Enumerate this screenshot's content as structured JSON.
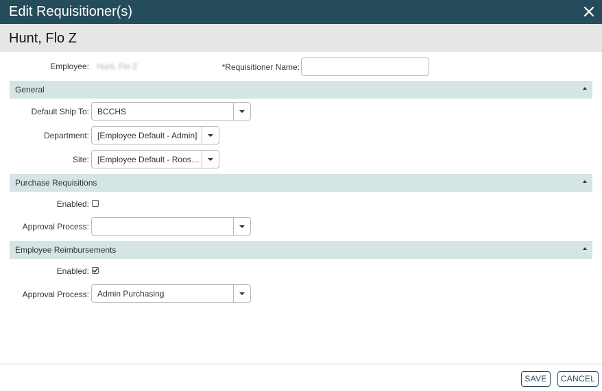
{
  "dialog": {
    "title": "Edit Requisitioner(s)",
    "person_name": "Hunt, Flo Z"
  },
  "top_fields": {
    "employee_label": "Employee:",
    "employee_value": "Hunt, Flo Z",
    "required_marker": "*",
    "requisitioner_name_label": "Requisitioner Name:",
    "requisitioner_name_value": ""
  },
  "sections": {
    "general": {
      "title": "General",
      "default_ship_to_label": "Default Ship To:",
      "default_ship_to_value": "BCCHS",
      "department_label": "Department:",
      "department_value": "[Employee Default - Admin]",
      "site_label": "Site:",
      "site_value": "[Employee Default - Roosevelt]"
    },
    "purchase_requisitions": {
      "title": "Purchase Requisitions",
      "enabled_label": "Enabled:",
      "enabled": false,
      "approval_process_label": "Approval Process:",
      "approval_process_value": ""
    },
    "employee_reimbursements": {
      "title": "Employee Reimbursements",
      "enabled_label": "Enabled:",
      "enabled": true,
      "approval_process_label": "Approval Process:",
      "approval_process_value": "Admin Purchasing"
    }
  },
  "footer": {
    "save_label": "SAVE",
    "cancel_label": "CANCEL"
  },
  "colors": {
    "title_bar": "#244c5a",
    "person_band": "#e6e6e6",
    "section_header": "#d5e4e5",
    "required": "#cc0000"
  }
}
